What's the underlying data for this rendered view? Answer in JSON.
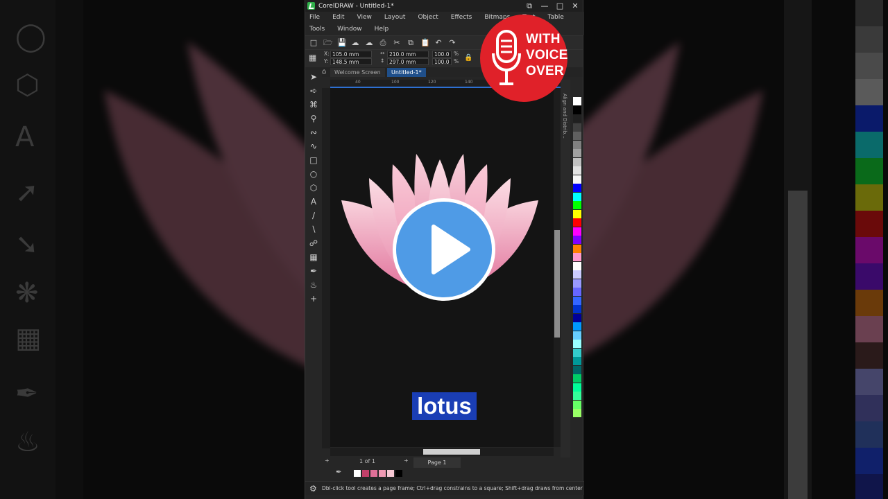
{
  "window": {
    "title": "CorelDRAW - Untitled-1*",
    "controls": [
      "⧉",
      "—",
      "□",
      "✕"
    ]
  },
  "menu": {
    "items": [
      "File",
      "Edit",
      "View",
      "Layout",
      "Object",
      "Effects",
      "Bitmaps",
      "Text",
      "Table",
      "Tools",
      "Window",
      "Help"
    ]
  },
  "property_bar": {
    "x_label": "X:",
    "x_value": "105.0 mm",
    "y_label": "Y:",
    "y_value": "148.5 mm",
    "width_value": "210.0 mm",
    "height_value": "297.0 mm",
    "scale_w": "100.0",
    "scale_h": "100.0",
    "percent": "%"
  },
  "doc_tabs": {
    "welcome": "Welcome Screen",
    "active": "Untitled-1*"
  },
  "ruler": {
    "ticks": [
      "40",
      "100",
      "120",
      "140"
    ]
  },
  "docker": {
    "label": "Align and Distrib..."
  },
  "page_nav": {
    "count": "1 of 1",
    "page_tab": "Page 1"
  },
  "status": {
    "hint": "Dbl-click tool creates a page frame; Ctrl+drag constrains to a square; Shift+drag draws from center"
  },
  "overlay": {
    "badge_line1": "WITH",
    "badge_line2": "VOICE",
    "badge_line3": "OVER",
    "caption": "lotus"
  },
  "colors": {
    "badge": "#e02129",
    "play": "#4f9be6",
    "caption_bg": "#1a3eb5",
    "active_tab": "#1f4f8a",
    "lotus_light": "#f6c8d4",
    "lotus_dark": "#e07098"
  },
  "icons": {
    "toolbox": [
      "pick-tool-icon",
      "shape-tool-icon",
      "crop-tool-icon",
      "zoom-tool-icon",
      "freehand-tool-icon",
      "artistic-media-icon",
      "rectangle-tool-icon",
      "ellipse-tool-icon",
      "polygon-tool-icon",
      "text-tool-icon",
      "parallel-dimension-icon",
      "connector-tool-icon",
      "blend-tool-icon",
      "transparency-tool-icon",
      "eyedropper-icon",
      "fill-tool-icon",
      "add-tool-icon"
    ]
  },
  "palette": [
    "#ffffff",
    "#000000",
    "#202020",
    "#404040",
    "#606060",
    "#808080",
    "#a0a0a0",
    "#c0c0c0",
    "#e0e0e0",
    "#f5f5f5",
    "#0000ff",
    "#00ffff",
    "#00ff00",
    "#ffff00",
    "#ff0000",
    "#ff00ff",
    "#8000ff",
    "#ff8000",
    "#ff99cc",
    "#ffffff",
    "#ccccff",
    "#9999ff",
    "#6666ff",
    "#3366ff",
    "#0033cc",
    "#000099",
    "#0099ff",
    "#66ccff",
    "#99ffff",
    "#33cccc",
    "#009999",
    "#006666",
    "#00cc66",
    "#00ff99",
    "#33ff99",
    "#66ff66",
    "#99ff66"
  ],
  "doc_swatches": [
    "#ffffff",
    "#c2406a",
    "#e07098",
    "#f09ab4",
    "#f6c8d4",
    "#000000"
  ]
}
